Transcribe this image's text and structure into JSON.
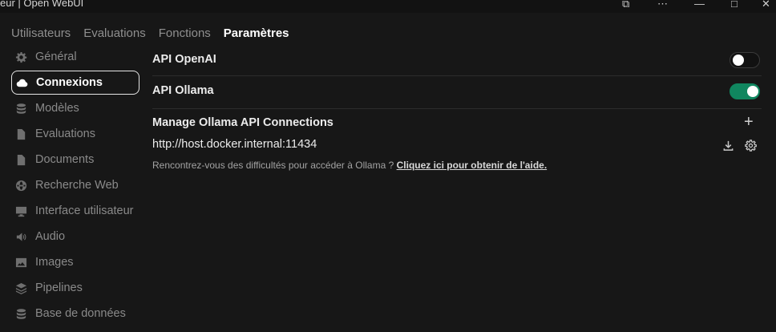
{
  "window": {
    "title": "eur | Open WebUI",
    "buttons": [
      "⧉",
      "⋯",
      "—",
      "□",
      "✕"
    ]
  },
  "tabs": [
    {
      "label": "Utilisateurs"
    },
    {
      "label": "Evaluations"
    },
    {
      "label": "Fonctions"
    },
    {
      "label": "Paramètres",
      "active": true
    }
  ],
  "sidebar": {
    "items": [
      {
        "label": "Général",
        "icon": "gear-icon"
      },
      {
        "label": "Connexions",
        "icon": "cloud-icon",
        "active": true
      },
      {
        "label": "Modèles",
        "icon": "database-icon"
      },
      {
        "label": "Evaluations",
        "icon": "document-icon"
      },
      {
        "label": "Documents",
        "icon": "file-icon"
      },
      {
        "label": "Recherche Web",
        "icon": "globe-icon"
      },
      {
        "label": "Interface utilisateur",
        "icon": "monitor-icon"
      },
      {
        "label": "Audio",
        "icon": "speaker-icon"
      },
      {
        "label": "Images",
        "icon": "image-icon"
      },
      {
        "label": "Pipelines",
        "icon": "layers-icon"
      },
      {
        "label": "Base de données",
        "icon": "database-icon"
      }
    ]
  },
  "connections": {
    "openai": {
      "label": "API OpenAI",
      "enabled": false
    },
    "ollama": {
      "label": "API Ollama",
      "enabled": true
    },
    "manage_title": "Manage Ollama API Connections",
    "url": "http://host.docker.internal:11434",
    "help_text": "Rencontrez-vous des difficultés pour accéder à Ollama ?",
    "help_link": "Cliquez ici pour obtenir de l'aide.",
    "accent_color": "#10865f"
  }
}
